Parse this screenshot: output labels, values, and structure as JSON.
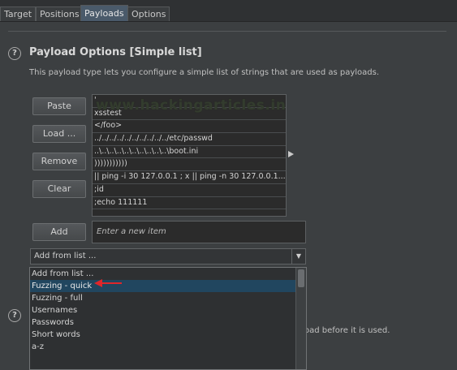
{
  "tabs": [
    {
      "label": "Target"
    },
    {
      "label": "Positions"
    },
    {
      "label": "Payloads"
    },
    {
      "label": "Options"
    }
  ],
  "payload_options": {
    "title": "Payload Options [Simple list]",
    "description": "This payload type lets you configure a simple list of strings that are used as payloads.",
    "buttons": {
      "paste": "Paste",
      "load": "Load ...",
      "remove": "Remove",
      "clear": "Clear",
      "add": "Add"
    },
    "list_items": [
      "'",
      "xsstest",
      "</foo>",
      "../../../../../../../../../../etc/passwd",
      "..\\..\\..\\..\\..\\..\\..\\..\\..\\..\\boot.ini",
      ")))))))))))",
      "|| ping -i 30 127.0.0.1 ; x || ping -n 30 127.0.0.1...",
      ";id",
      ";echo 111111"
    ],
    "new_item_placeholder": "Enter a new item",
    "add_from_list_selected": "Add from list ...",
    "dropdown_options": [
      "Add from list ...",
      "Fuzzing - quick",
      "Fuzzing - full",
      "Usernames",
      "Passwords",
      "Short words",
      "a-z"
    ],
    "watermark": "www.hackingarticles.in"
  },
  "background_text": "oad before it is used.",
  "colors": {
    "selected_option": "#21465f",
    "annotation_arrow": "#e0262a",
    "active_tab": "#4a5a6a"
  }
}
